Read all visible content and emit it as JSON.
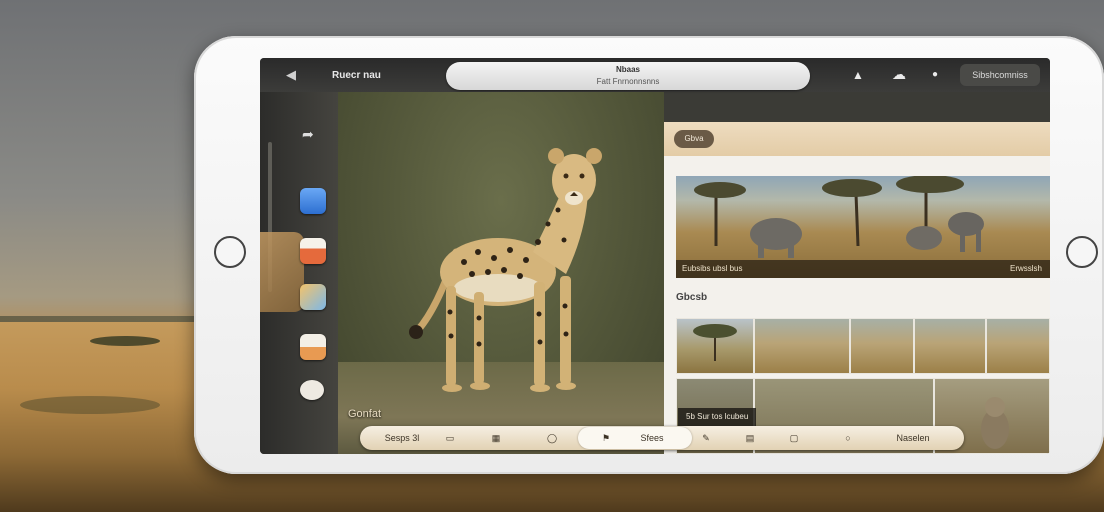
{
  "app": {
    "title": "Ruecr nau",
    "url_line1": "Nbaas",
    "url_line2": "Fatt Fnrnonnsnns"
  },
  "topbar": {
    "back_icon": "back-arrow-icon",
    "right_button": "Sibshcomniss"
  },
  "dock": {
    "apps": [
      "messages-app-icon",
      "mail-app-icon",
      "photos-app-icon",
      "calendar-app-icon",
      "camera-app-icon"
    ]
  },
  "photo": {
    "caption": "Gonfat",
    "subject": "cheetah"
  },
  "panel": {
    "pill_label": "Gbva",
    "hero_caption_left": "Eubsibs ubsl bus",
    "hero_caption_right": "Erwsslsh",
    "section_title": "Gbcsb",
    "tile_label": "5b   Sur tos lcubeu"
  },
  "toolbar": {
    "items": [
      "Sesps 3l",
      "",
      "Sfees",
      "",
      "Naselen"
    ]
  },
  "colors": {
    "device_body": "#f4f4f4",
    "toolbar": "#efe3cc",
    "panel_header": "#e8d4b2"
  }
}
